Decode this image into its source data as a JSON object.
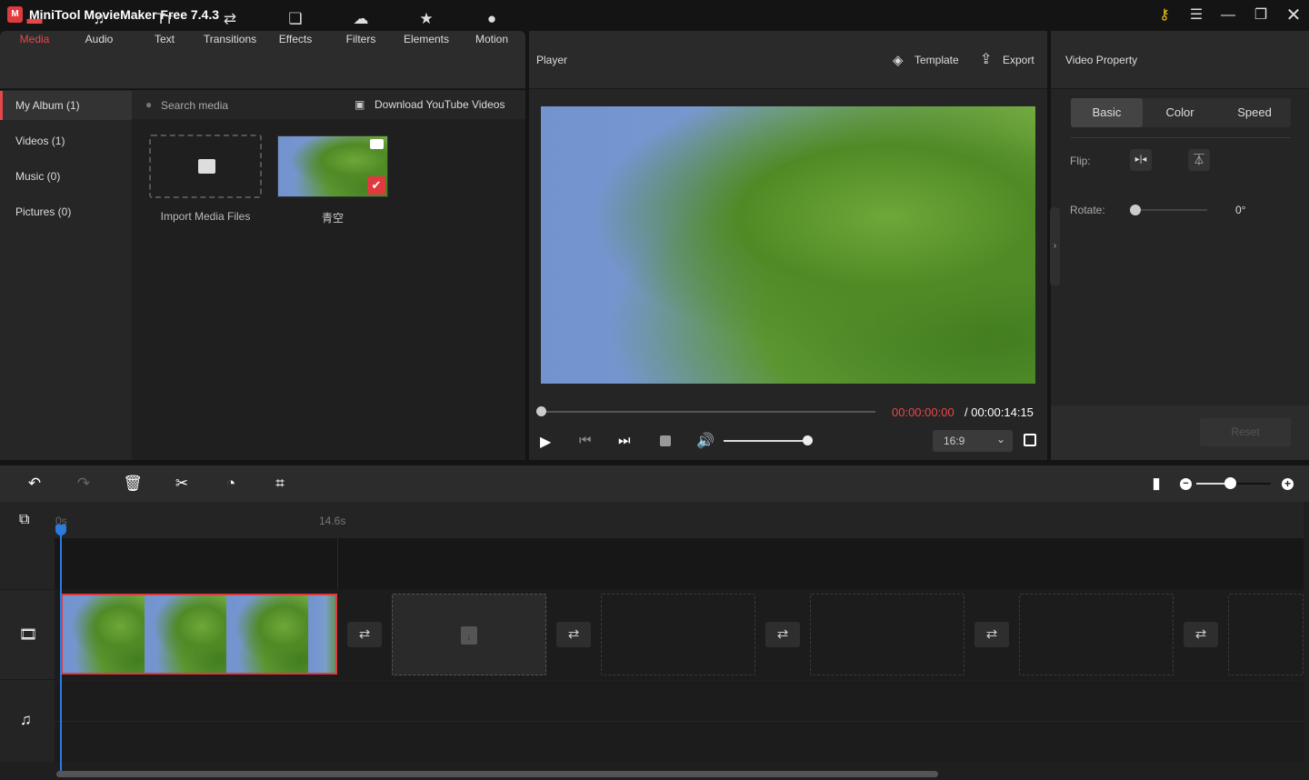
{
  "app": {
    "title": "MiniTool MovieMaker Free 7.4.3",
    "key_color": "#f1c40f"
  },
  "tabs": [
    {
      "label": "Media",
      "icon": "folder-icon"
    },
    {
      "label": "Audio",
      "icon": "music-note-icon"
    },
    {
      "label": "Text",
      "icon": "text-icon"
    },
    {
      "label": "Transitions",
      "icon": "swap-icon"
    },
    {
      "label": "Effects",
      "icon": "effects-icon"
    },
    {
      "label": "Filters",
      "icon": "filters-icon"
    },
    {
      "label": "Elements",
      "icon": "elements-icon"
    },
    {
      "label": "Motion",
      "icon": "motion-icon"
    }
  ],
  "sidebar": {
    "items": [
      {
        "label": "My Album (1)"
      },
      {
        "label": "Videos (1)"
      },
      {
        "label": "Music (0)"
      },
      {
        "label": "Pictures (0)"
      }
    ]
  },
  "media": {
    "search_placeholder": "Search media",
    "download_label": "Download YouTube Videos",
    "import_label": "Import Media Files",
    "clip_name": "青空"
  },
  "player": {
    "title": "Player",
    "template_label": "Template",
    "export_label": "Export",
    "current_time": "00:00:00:00",
    "total_time": "/ 00:00:14:15",
    "aspect_ratio": "16:9",
    "progress": 0,
    "volume": 0.9
  },
  "property": {
    "title": "Video Property",
    "tabs": [
      "Basic",
      "Color",
      "Speed"
    ],
    "active_tab": "Basic",
    "flip_label": "Flip:",
    "rotate_label": "Rotate:",
    "rotate_value": "0°",
    "reset_label": "Reset"
  },
  "timeline": {
    "ruler_start": "0s",
    "ruler_mark": "14.6s",
    "zoom_level": 0.45
  },
  "accent": "#e8474a"
}
